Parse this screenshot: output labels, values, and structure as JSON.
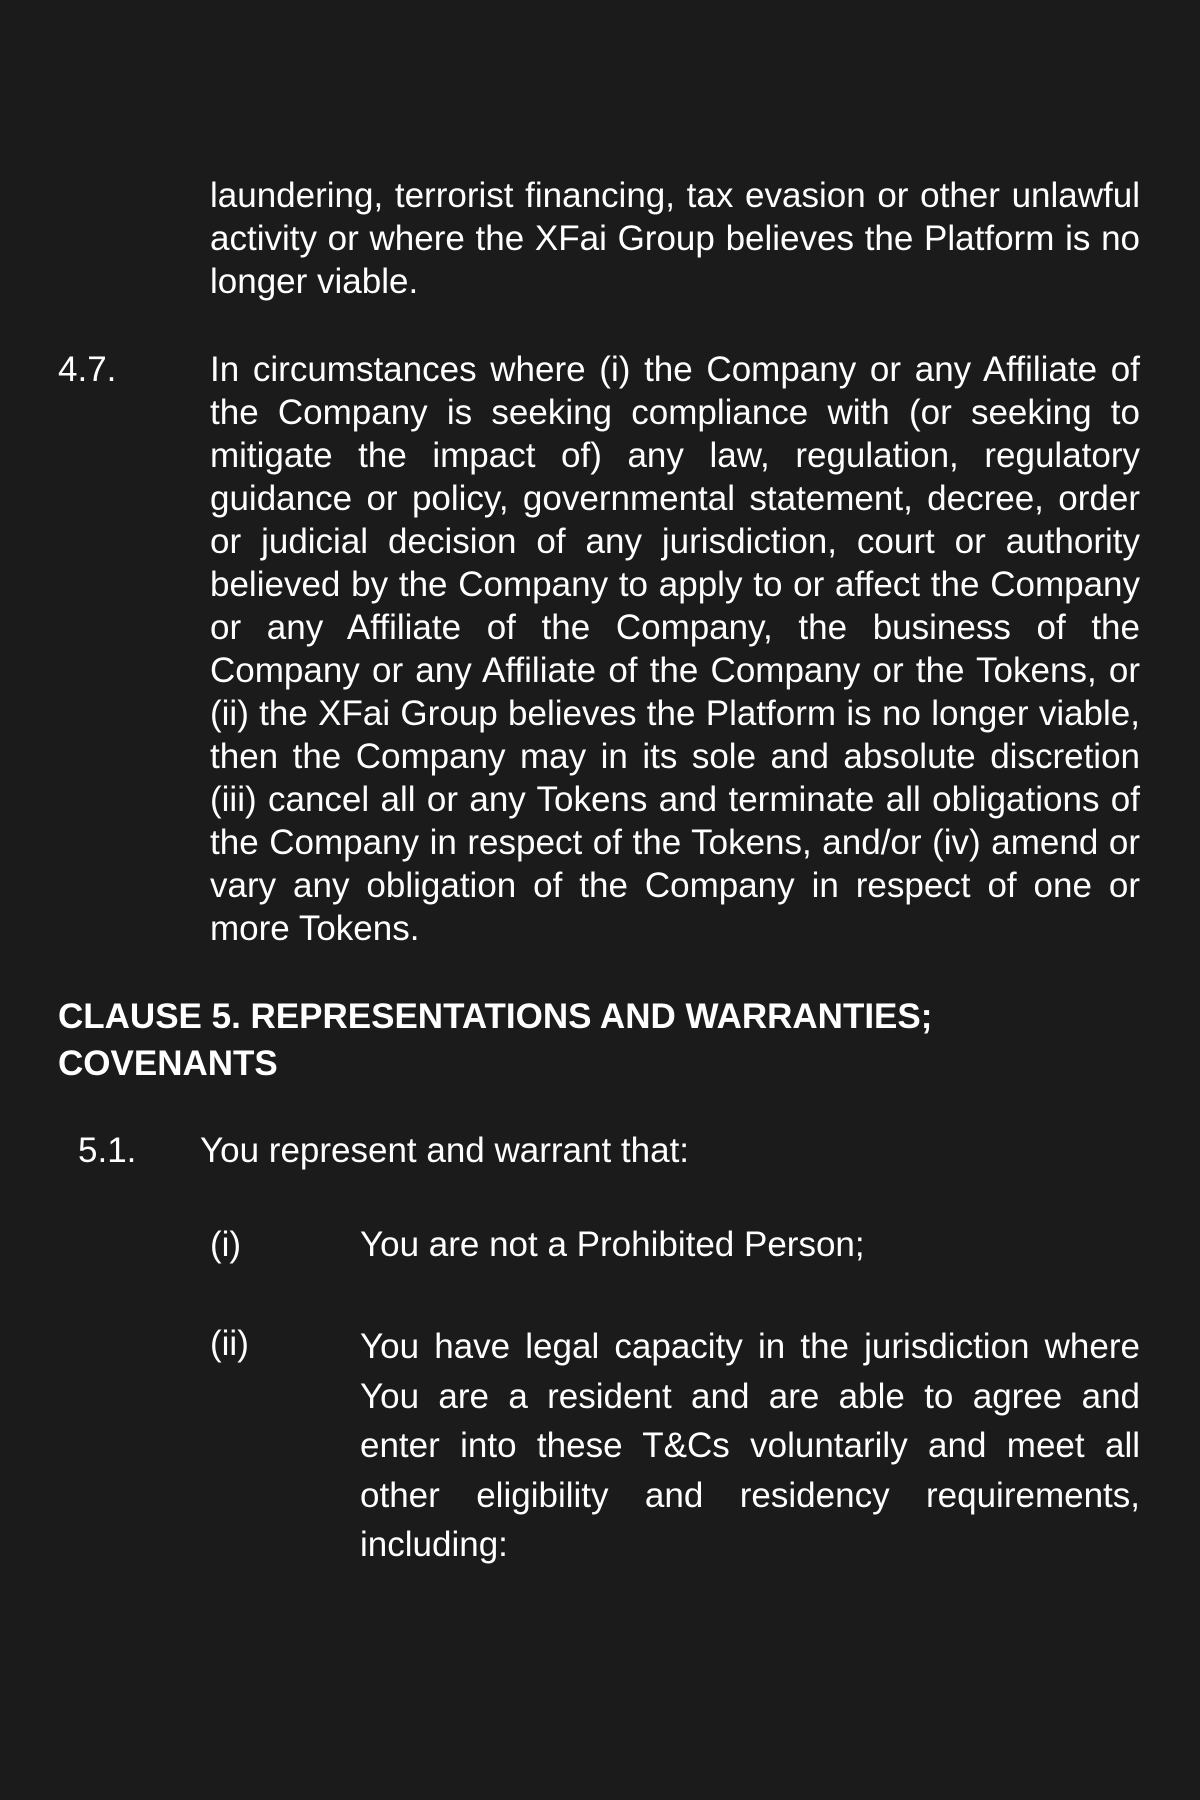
{
  "document": {
    "continuation_text": "laundering, terrorist financing, tax evasion or other unlawful activity or where the XFai Group believes the Platform is no longer viable.",
    "clause_4_7": {
      "number": "4.7.",
      "text": "In circumstances where (i) the Company or any Affiliate of the Company is seeking compliance with (or seeking to mitigate the impact of) any law, regulation, regulatory guidance or policy, governmental statement, decree, order or judicial decision of any jurisdiction, court or authority believed by the Company to apply to or affect the Company or any Affiliate of the Company, the business of the Company or any Affiliate of the Company or the Tokens, or (ii) the XFai Group believes the Platform is no longer viable, then the Company may in its sole and absolute discretion (iii) cancel all or any Tokens and terminate all obligations of the Company in respect of the Tokens, and/or (iv) amend or vary any obligation of the Company in respect of one or more Tokens."
    },
    "clause_5_heading_line1": "CLAUSE 5. REPRESENTATIONS AND WARRANTIES;",
    "clause_5_heading_line2": "COVENANTS",
    "clause_5_1": {
      "number": "5.1.",
      "text": "You represent and warrant that:"
    },
    "items": [
      {
        "number": "(i)",
        "text": "You are not a Prohibited Person;"
      },
      {
        "number": "(ii)",
        "text": "You have legal capacity in the jurisdiction where You are a resident and are able to agree and enter into these T&Cs voluntarily and meet all other eligibility and residency requirements, including:"
      }
    ]
  }
}
